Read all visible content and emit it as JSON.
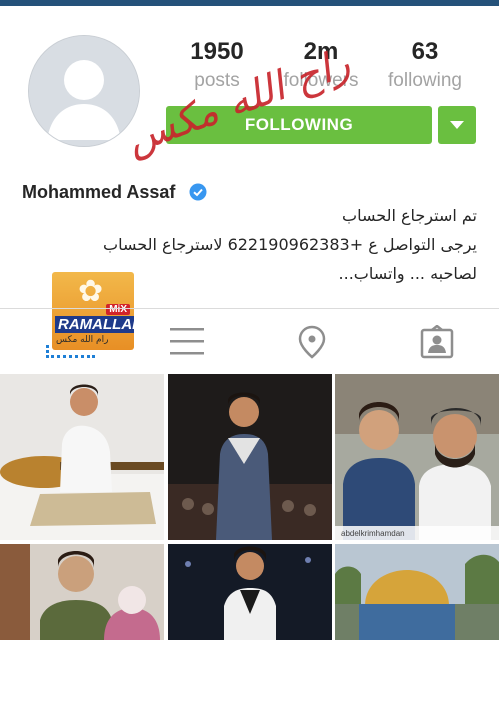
{
  "profile": {
    "stats": [
      {
        "value": "1950",
        "label": "posts"
      },
      {
        "value": "2m",
        "label": "followers"
      },
      {
        "value": "63",
        "label": "following"
      }
    ],
    "follow_label": "FOLLOWING",
    "username": "Mohammed Assaf",
    "watermark": "راح الله مكس",
    "bio": [
      "تم استرجاع الحساب",
      "يرجى التواصل ع   +622190962383 لاسترجاع الحساب",
      "لصاحبه  ... واتساب..."
    ]
  },
  "logo": {
    "mix": "MiX",
    "ramallah": "RAMALLAH",
    "arabic": "رام الله مكس"
  },
  "tabs": [
    {
      "icon": "grid-icon"
    },
    {
      "icon": "list-icon"
    },
    {
      "icon": "location-pin-icon"
    },
    {
      "icon": "tagged-person-icon"
    }
  ],
  "grid": {
    "photo_caption": "abdelkrimhamdan"
  },
  "colors": {
    "accent_green": "#6abf40",
    "verified_blue": "#3897f0",
    "watermark_red": "#c8252c",
    "top_bar": "#25527a"
  }
}
